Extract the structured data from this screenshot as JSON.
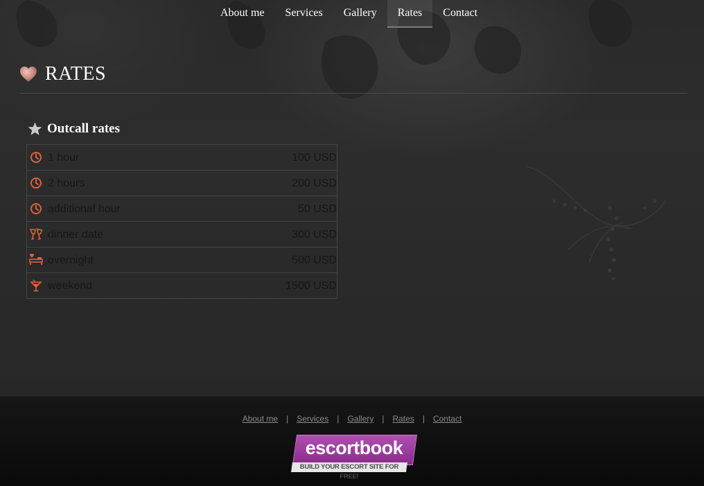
{
  "nav": {
    "items": [
      {
        "label": "About me",
        "active": false
      },
      {
        "label": "Services",
        "active": false
      },
      {
        "label": "Gallery",
        "active": false
      },
      {
        "label": "Rates",
        "active": true
      },
      {
        "label": "Contact",
        "active": false
      }
    ]
  },
  "page": {
    "title": "RATES",
    "icon": "heart-icon"
  },
  "section": {
    "title": "Outcall rates",
    "icon": "star-icon"
  },
  "rates": [
    {
      "icon": "clock-icon",
      "label": "1 hour",
      "price": "100 USD"
    },
    {
      "icon": "clock-icon",
      "label": "2 hours",
      "price": "200 USD"
    },
    {
      "icon": "clock-icon",
      "label": "additional hour",
      "price": "50 USD"
    },
    {
      "icon": "wine-glasses-icon",
      "label": "dinner date",
      "price": "300 USD"
    },
    {
      "icon": "bed-heart-icon",
      "label": "overnight",
      "price": "500 USD"
    },
    {
      "icon": "cocktail-icon",
      "label": "weekend",
      "price": "1500 USD"
    }
  ],
  "footer": {
    "links": [
      "About me",
      "Services",
      "Gallery",
      "Rates",
      "Contact"
    ],
    "separator": "|",
    "badge": {
      "name": "escortbook",
      "tagline": "BUILD YOUR ESCORT SITE FOR FREE!"
    }
  },
  "colors": {
    "icon_accent": "#e0603a",
    "nav_active_underline": "#7d7d7d",
    "badge_purple": "#9c3a9e",
    "background": "#2a2a2a",
    "footer_background": "#111111"
  }
}
